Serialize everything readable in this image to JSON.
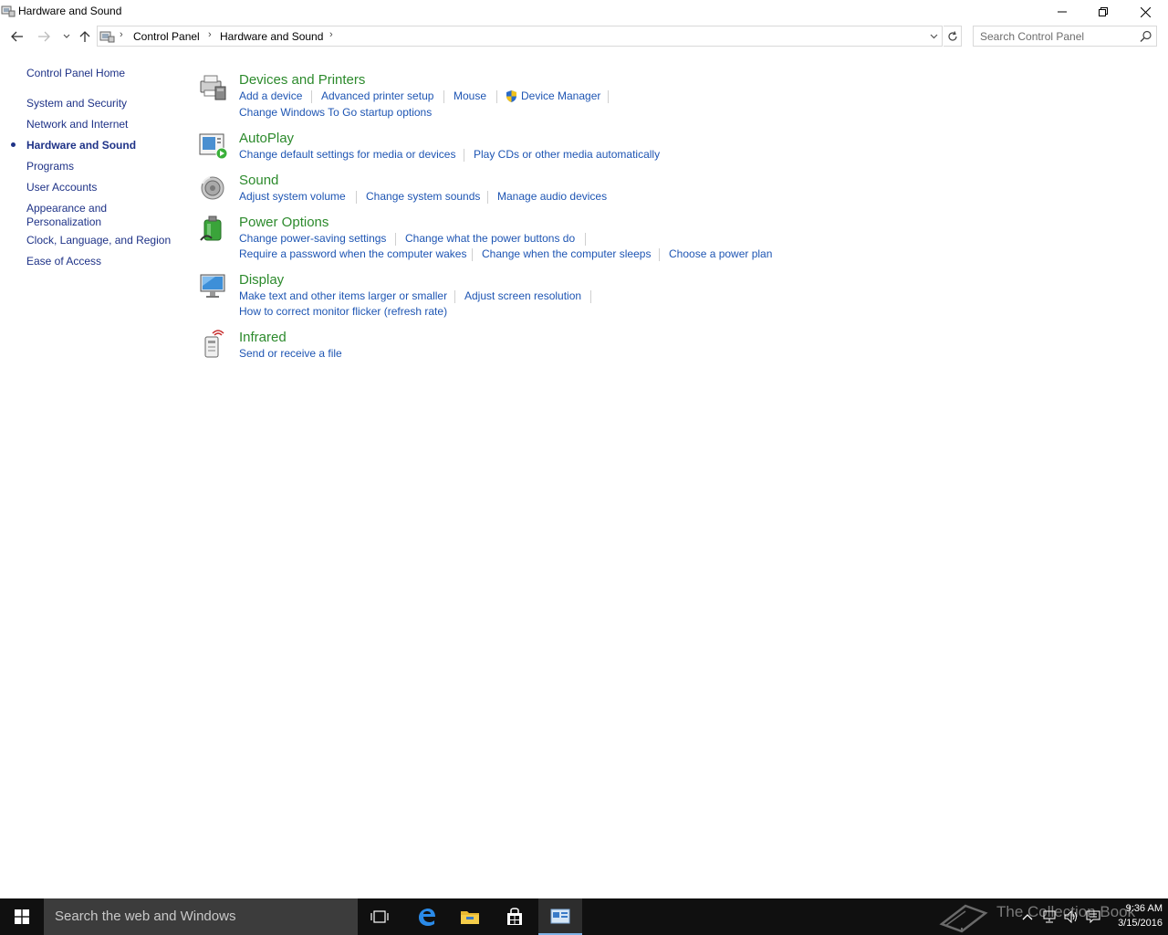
{
  "window": {
    "title": "Hardware and Sound",
    "icon": "control-panel-hardware-icon"
  },
  "address_bar": {
    "breadcrumbs": [
      "Control Panel",
      "Hardware and Sound"
    ],
    "search_placeholder": "Search Control Panel"
  },
  "left_nav": {
    "items": [
      {
        "label": "Control Panel Home",
        "current": false
      },
      {
        "label": "System and Security",
        "current": false
      },
      {
        "label": "Network and Internet",
        "current": false
      },
      {
        "label": "Hardware and Sound",
        "current": true
      },
      {
        "label": "Programs",
        "current": false
      },
      {
        "label": "User Accounts",
        "current": false
      },
      {
        "label": "Appearance and",
        "label2": "Personalization",
        "current": false
      },
      {
        "label": "Clock, Language, and Region",
        "current": false
      },
      {
        "label": "Ease of Access",
        "current": false
      }
    ]
  },
  "categories": {
    "devices": {
      "title": "Devices and Printers",
      "icon": "printer-icon",
      "links": [
        "Add a device",
        "Advanced printer setup",
        "Mouse",
        "Device Manager",
        "Change Windows To Go startup options"
      ]
    },
    "autoplay": {
      "title": "AutoPlay",
      "icon": "autoplay-icon",
      "links": [
        "Change default settings for media or devices",
        "Play CDs or other media automatically"
      ]
    },
    "sound": {
      "title": "Sound",
      "icon": "speaker-icon",
      "links": [
        "Adjust system volume",
        "Change system sounds",
        "Manage audio devices"
      ]
    },
    "power": {
      "title": "Power Options",
      "icon": "battery-icon",
      "links": [
        "Change power-saving settings",
        "Change what the power buttons do",
        "Require a password when the computer wakes",
        "Change when the computer sleeps",
        "Choose a power plan"
      ]
    },
    "display": {
      "title": "Display",
      "icon": "monitor-icon",
      "links": [
        "Make text and other items larger or smaller",
        "Adjust screen resolution",
        "How to correct monitor flicker (refresh rate)"
      ]
    },
    "infrared": {
      "title": "Infrared",
      "icon": "infrared-icon",
      "links": [
        "Send or receive a file"
      ]
    }
  },
  "taskbar": {
    "search_text": "Search the web and Windows",
    "watermark": "The Collection Book",
    "time": "9:36 AM",
    "date": "3/15/2016"
  },
  "colors": {
    "category_title": "#2c8a2c",
    "link": "#1e55b3",
    "nav_link": "#1e3287",
    "taskbar": "#101010"
  }
}
